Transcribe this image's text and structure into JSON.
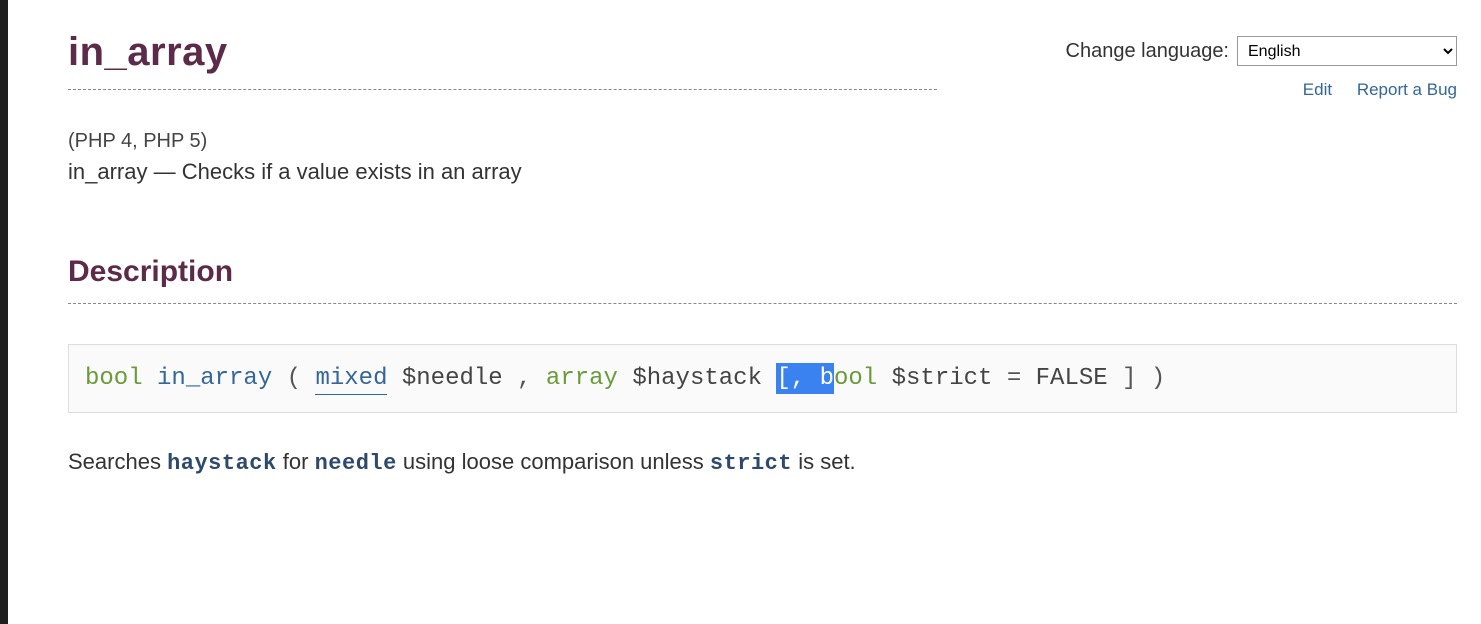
{
  "topbar": {
    "change_language_label": "Change language:",
    "language_selected": "English",
    "edit": "Edit",
    "report_bug": "Report a Bug"
  },
  "title": "in_array",
  "versions": "(PHP 4, PHP 5)",
  "purpose_func": "in_array",
  "purpose_sep": " — ",
  "purpose_text": "Checks if a value exists in an array",
  "sections": {
    "description": "Description"
  },
  "synopsis": {
    "return_type": "bool",
    "name": "in_array",
    "p1_type": "mixed",
    "p1_name": "$needle",
    "p2_type": "array",
    "p2_name": "$haystack",
    "opt_open_sel": "[, b",
    "opt_type_rest": "ool",
    "opt_name": "$strict",
    "opt_default": "FALSE"
  },
  "description_sentence": {
    "pre": "Searches ",
    "haystack": "haystack",
    "mid1": " for ",
    "needle": "needle",
    "mid2": " using loose comparison unless ",
    "strict": "strict",
    "post": " is set."
  }
}
